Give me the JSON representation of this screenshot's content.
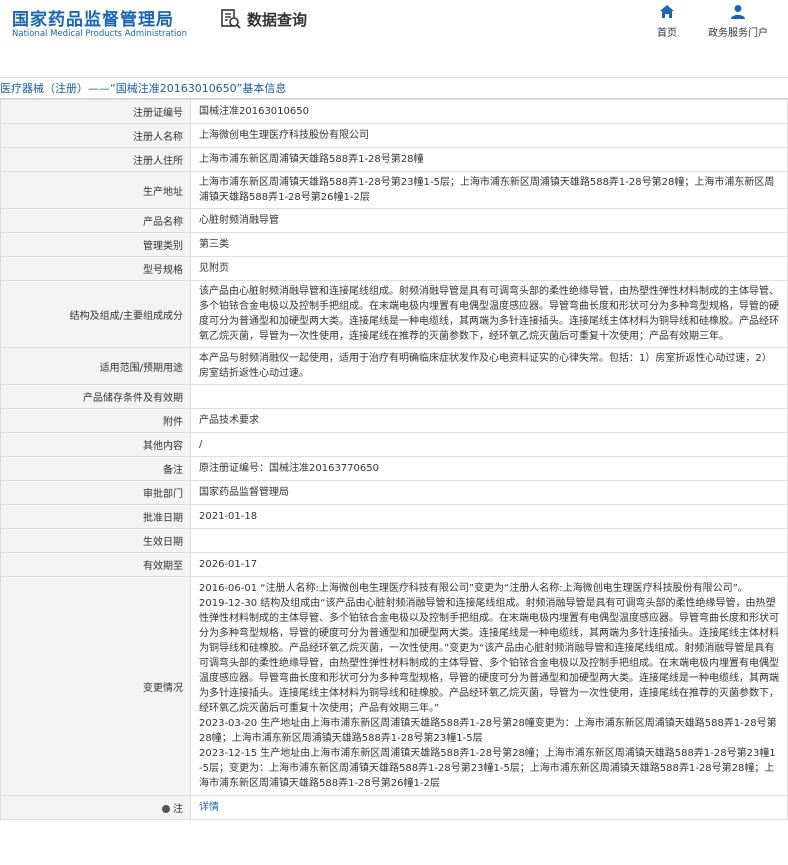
{
  "header": {
    "logo_cn": "国家药品监督管理局",
    "logo_en": "National Medical Products Administration",
    "query_title": "数据查询",
    "nav": [
      {
        "label": "首页",
        "icon": "home-icon"
      },
      {
        "label": "政务服务门户",
        "icon": "user-icon"
      }
    ]
  },
  "breadcrumb": "医疗器械（注册）——“国械注准20163010650”基本信息",
  "rows": [
    {
      "label": "注册证编号",
      "value": "国械注准20163010650"
    },
    {
      "label": "注册人名称",
      "value": "上海微创电生理医疗科技股份有限公司"
    },
    {
      "label": "注册人住所",
      "value": "上海市浦东新区周浦镇天雄路588弄1-28号第28幢"
    },
    {
      "label": "生产地址",
      "value": "上海市浦东新区周浦镇天雄路588弄1-28号第23幢1-5层；上海市浦东新区周浦镇天雄路588弄1-28号第28幢；上海市浦东新区周浦镇天雄路588弄1-28号第26幢1-2层"
    },
    {
      "label": "产品名称",
      "value": "心脏射频消融导管"
    },
    {
      "label": "管理类别",
      "value": "第三类"
    },
    {
      "label": "型号规格",
      "value": "见附页"
    },
    {
      "label": "结构及组成/主要组成成分",
      "value": "该产品由心脏射频消融导管和连接尾线组成。射频消融导管是具有可调弯头部的柔性绝缘导管，由热塑性弹性材料制成的主体导管、多个铂铱合金电极以及控制手把组成。在末端电极内埋置有电偶型温度感应器。导管弯曲长度和形状可分为多种弯型规格，导管的硬度可分为普通型和加硬型两大类。连接尾线是一种电缆线，其两端为多针连接插头。连接尾线主体材料为铜导线和硅橡胶。产品经环氧乙烷灭菌，导管为一次性使用，连接尾线在推荐的灭菌参数下，经环氧乙烷灭菌后可重复十次使用；产品有效期三年。"
    },
    {
      "label": "适用范围/预期用途",
      "value": "本产品与射频消融仪一起使用，适用于治疗有明确临床症状发作及心电资料证实的心律失常。包括：1）房室折返性心动过速，2）房室结折返性心动过速。"
    },
    {
      "label": "产品储存条件及有效期",
      "value": ""
    },
    {
      "label": "附件",
      "value": "产品技术要求"
    },
    {
      "label": "其他内容",
      "value": "/"
    },
    {
      "label": "备注",
      "value": "原注册证编号：国械注准20163770650"
    },
    {
      "label": "审批部门",
      "value": "国家药品监督管理局"
    },
    {
      "label": "批准日期",
      "value": "2021-01-18"
    },
    {
      "label": "生效日期",
      "value": ""
    },
    {
      "label": "有效期至",
      "value": "2026-01-17"
    }
  ],
  "changes": {
    "label": "变更情况",
    "lines": [
      "2016-06-01 “注册人名称:上海微创电生理医疗科技有限公司”变更为“注册人名称:上海微创电生理医疗科技股份有限公司”。",
      "2019-12-30 结构及组成由“该产品由心脏射频消融导管和连接尾线组成。射频消融导管是具有可调弯头部的柔性绝缘导管，由热塑性弹性材料制成的主体导管、多个铂铱合金电极以及控制手把组成。在末端电极内埋置有电偶型温度感应器。导管弯曲长度和形状可分为多种弯型规格，导管的硬度可分为普通型和加硬型两大类。连接尾线是一种电缆线，其两端为多针连接插头。连接尾线主体材料为铜导线和硅橡胶。产品经环氧乙烷灭菌，一次性使用。”变更为“该产品由心脏射频消融导管和连接尾线组成。射频消融导管是具有可调弯头部的柔性绝缘导管，由热塑性弹性材料制成的主体导管、多个铂铱合金电极以及控制手把组成。在末端电极内埋置有电偶型温度感应器。导管弯曲长度和形状可分为多种弯型规格，导管的硬度可分为普通型和加硬型两大类。连接尾线是一种电缆线，其两端为多针连接插头。连接尾线主体材料为铜导线和硅橡胶。产品经环氧乙烷灭菌，导管为一次性使用，连接尾线在推荐的灭菌参数下，经环氧乙烷灭菌后可重复十次使用；产品有效期三年。”",
      "2023-03-20 生产地址由上海市浦东新区周浦镇天雄路588弄1-28号第28幢变更为：上海市浦东新区周浦镇天雄路588弄1-28号第28幢；上海市浦东新区周浦镇天雄路588弄1-28号第23幢1-5层",
      "2023-12-15 生产地址由上海市浦东新区周浦镇天雄路588弄1-28号第28幢；上海市浦东新区周浦镇天雄路588弄1-28号第23幢1-5层；变更为：上海市浦东新区周浦镇天雄路588弄1-28号第23幢1-5层；上海市浦东新区周浦镇天雄路588弄1-28号第28幢；上海市浦东新区周浦镇天雄路588弄1-28号第26幢1-2层"
    ]
  },
  "footer_note": {
    "label": "注",
    "icon": "info-icon",
    "link": "详情"
  }
}
